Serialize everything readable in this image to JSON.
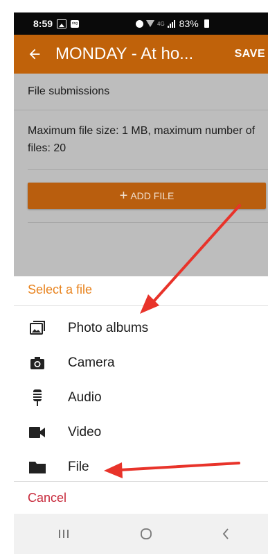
{
  "status_bar": {
    "time": "8:59",
    "network_label": "4G",
    "battery": "83%"
  },
  "app_bar": {
    "title": "MONDAY - At ho...",
    "save_label": "SAVE"
  },
  "content": {
    "section_title": "File submissions",
    "info_text": "Maximum file size: 1 MB, maximum number of files: 20",
    "add_file_label": "ADD FILE"
  },
  "sheet": {
    "title": "Select a file",
    "options": [
      {
        "label": "Photo albums",
        "icon": "photo-albums-icon"
      },
      {
        "label": "Camera",
        "icon": "camera-icon"
      },
      {
        "label": "Audio",
        "icon": "microphone-icon"
      },
      {
        "label": "Video",
        "icon": "video-camera-icon"
      },
      {
        "label": "File",
        "icon": "folder-icon"
      }
    ],
    "cancel_label": "Cancel"
  },
  "colors": {
    "app_bar": "#c0620a",
    "sheet_title": "#e8821c",
    "cancel": "#c7283a",
    "annotation_arrow": "#e8332a"
  }
}
